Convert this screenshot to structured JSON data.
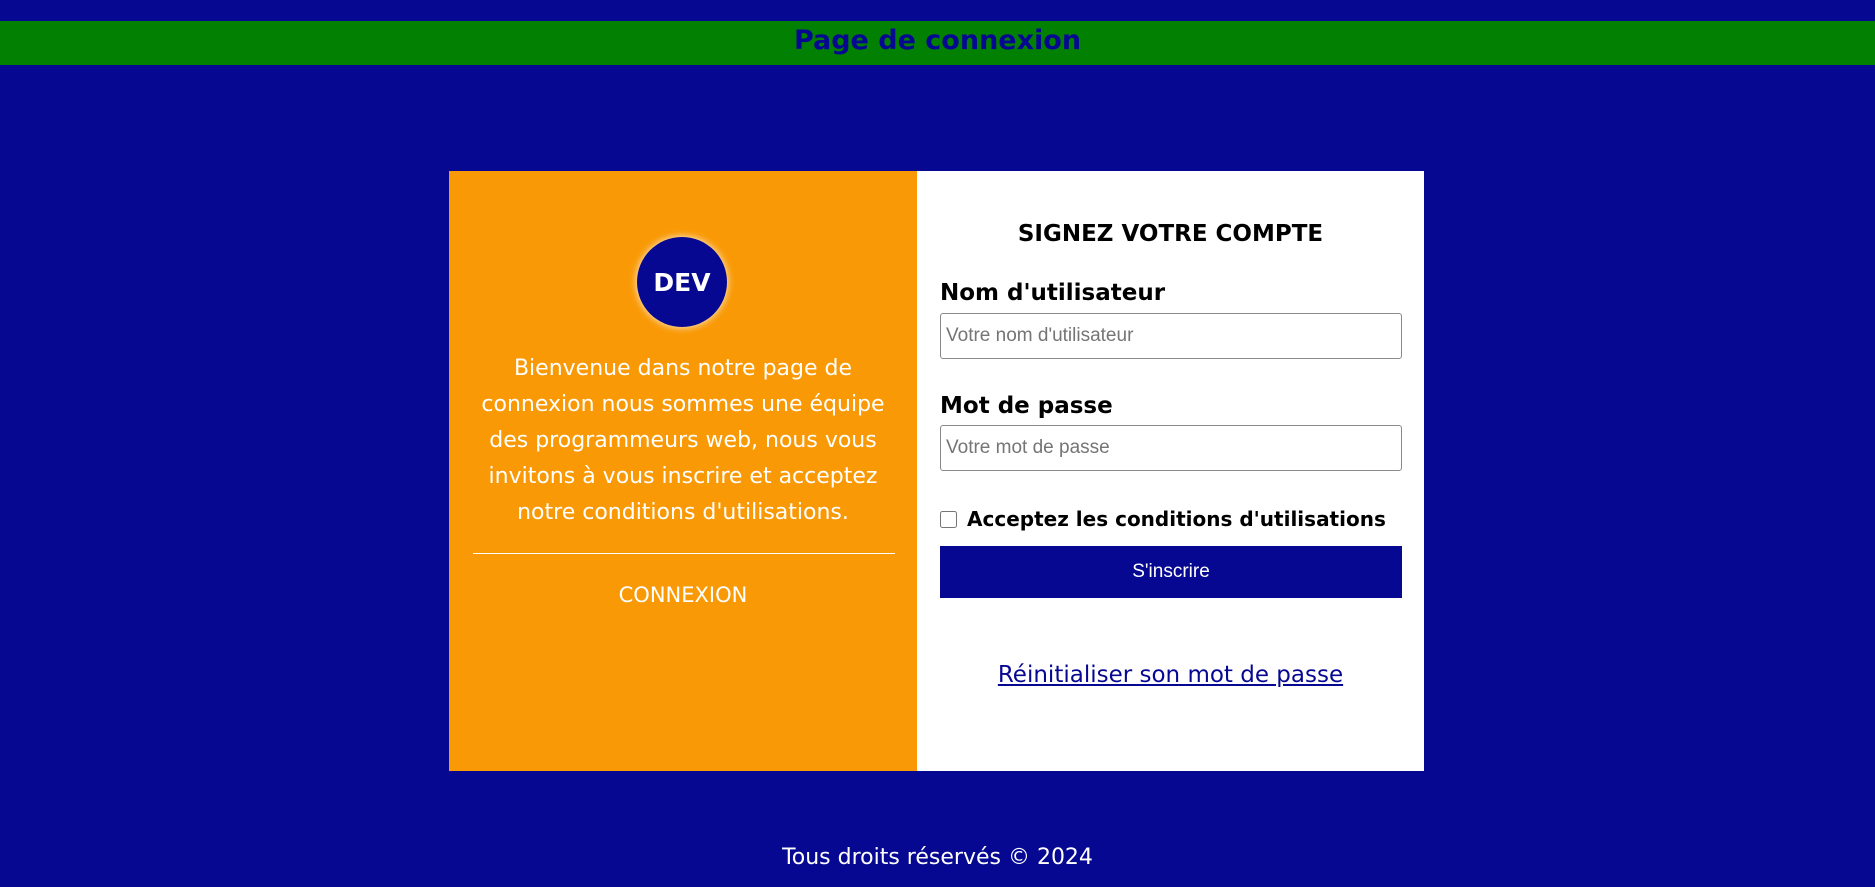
{
  "header": {
    "title": "Page de connexion"
  },
  "left_panel": {
    "logo_text": "DEV",
    "welcome": "Bienvenue dans notre page de connexion nous sommes une équipe des programmeurs web, nous vous invitons à vous inscrire et acceptez notre conditions d'utilisations.",
    "login_label": "CONNEXION"
  },
  "form": {
    "title": "SIGNEZ VOTRE COMPTE",
    "username_label": "Nom d'utilisateur",
    "username_placeholder": "Votre nom d'utilisateur",
    "username_value": "",
    "password_label": "Mot de passe",
    "password_placeholder": "Votre mot de passe",
    "password_value": "",
    "terms_label": "Acceptez les conditions d'utilisations",
    "terms_checked": false,
    "submit_label": "S'inscrire",
    "reset_link": "Réinitialiser son mot de passe"
  },
  "footer": {
    "text": "Tous droits réservés © 2024"
  },
  "colors": {
    "background": "#070892",
    "header_bar": "#028002",
    "left_panel": "#f99905",
    "button": "#070892"
  }
}
